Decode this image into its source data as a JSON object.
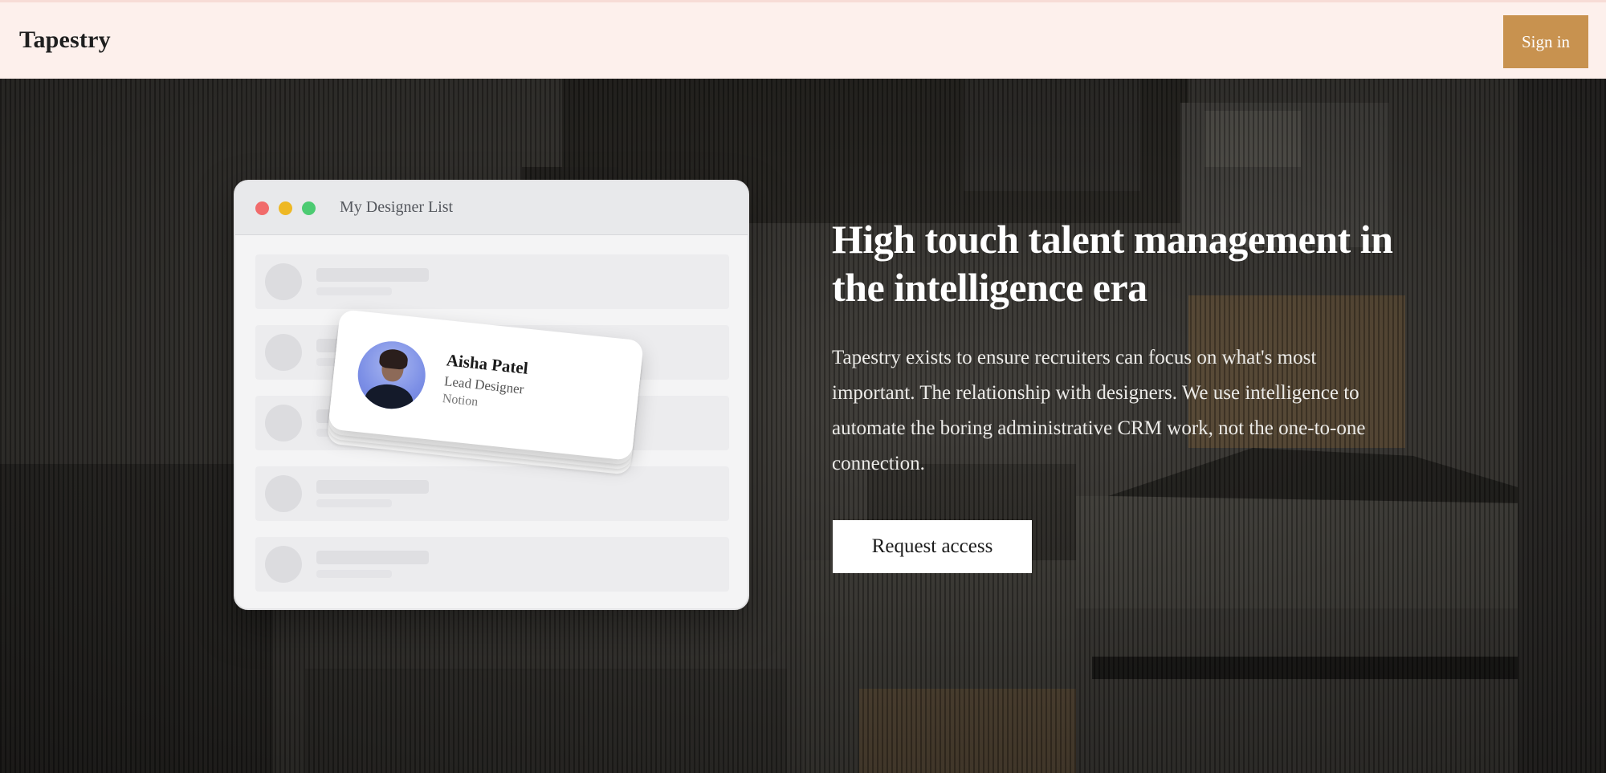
{
  "header": {
    "logo": "Tapestry",
    "signin_label": "Sign in"
  },
  "mockup": {
    "window_title": "My Designer List",
    "profile": {
      "name": "Aisha Patel",
      "role": "Lead Designer",
      "company": "Notion"
    }
  },
  "hero": {
    "headline": "High touch talent management in the intelligence era",
    "lead": "Tapestry exists to ensure recruiters can focus on what's most important. The relationship with designers. We use intelligence to automate the boring administrative CRM work, not the one-to-one connection.",
    "cta_label": "Request access"
  },
  "colors": {
    "header_bg": "#fdf0ec",
    "accent": "#c8924f",
    "hero_bg": "#3a3834"
  }
}
